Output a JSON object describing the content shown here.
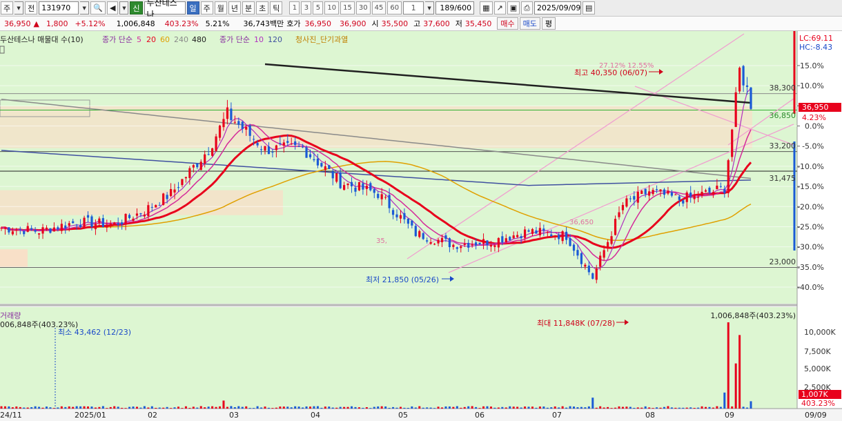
{
  "toolbar": {
    "market_select": "주",
    "prev_button": "전",
    "code": "131970",
    "stock_name": "두산테스나",
    "credit_badge": "신",
    "periods": [
      "일",
      "주",
      "월",
      "년",
      "분",
      "초",
      "틱"
    ],
    "active_period": "일",
    "interval_buttons": [
      "1",
      "3",
      "5",
      "10",
      "15",
      "30",
      "45",
      "60"
    ],
    "interval_value": "1",
    "page_counter": "189/600",
    "date": "2025/09/09"
  },
  "quote": {
    "price": "36,950",
    "change_arrow": "▲",
    "change": "1,800",
    "change_pct": "+5.12%",
    "volume": "1,006,848",
    "volume_ratio": "403.23%",
    "turnover_pct": "5.21%",
    "amount": "36,743백만",
    "hoga_label": "호가",
    "ask": "36,950",
    "bid": "36,900",
    "open_label": "시",
    "open": "35,500",
    "high_label": "고",
    "high": "37,600",
    "low_label": "저",
    "low": "35,450",
    "buy_button": "매수",
    "sell_button": "매도",
    "eval_button": "평"
  },
  "legend": {
    "title": "두산테스나 매물대 수(10)",
    "ma_price_label": "종가 단순",
    "ma_price_periods": [
      {
        "label": "5",
        "color": "#d42a9a"
      },
      {
        "label": "20",
        "color": "#e8001c"
      },
      {
        "label": "60",
        "color": "#e0a000"
      },
      {
        "label": "240",
        "color": "#8a8a8a"
      },
      {
        "label": "480",
        "color": "#202020"
      }
    ],
    "ma_price2_label": "종가 단순",
    "ma_price2_periods": [
      {
        "label": "10",
        "color": "#b030c0"
      },
      {
        "label": "120",
        "color": "#4050a0"
      }
    ],
    "signal_label": "청사진_단기과열"
  },
  "right_axis": {
    "lc": "LC:69.11",
    "hc": "HC:-8.43",
    "pct_ticks": [
      "15.0%",
      "10.0%",
      "5.0%",
      "0.0%",
      "-5.0%",
      "-10.0%",
      "-15.0%",
      "-20.0%",
      "-25.0%",
      "-30.0%",
      "-35.0%",
      "-40.0%"
    ],
    "current_price_tag": "36,950",
    "current_pct_tag": "4.23%"
  },
  "levels": [
    "38,300",
    "36,850",
    "33,200",
    "31,475",
    "23,000"
  ],
  "annotations": {
    "max_label": "최고 40,350 (06/07)",
    "min_label": "최저 21,850 (05/26)",
    "pct_near_max": "27.12% 12.55%",
    "price_label_mid": "36,650",
    "price_label_35": "35,"
  },
  "volume": {
    "title": "거래량",
    "current": "006,848주(403.23%)",
    "right_current": "1,006,848주(403.23%)",
    "min_label": "최소 43,462 (12/23)",
    "max_label": "최대 11,848K (07/28)",
    "ticks": [
      "10,000K",
      "7,500K",
      "5,000K",
      "2,500K"
    ],
    "tag_value": "1,007K",
    "tag_pct": "403.23%"
  },
  "x_axis": [
    "24/11",
    "2025/01",
    "02",
    "03",
    "04",
    "05",
    "06",
    "07",
    "08",
    "09",
    "09/09"
  ],
  "chart_data": {
    "type": "candlestick",
    "price_axis_range": [
      21850,
      40350
    ],
    "pct_range": [
      -40,
      15
    ],
    "reference_price": 35450,
    "max": {
      "price": 40350,
      "date": "06/07"
    },
    "min": {
      "price": 21850,
      "date": "05/26"
    },
    "volume_max": {
      "value_k": 11848,
      "date": "07/28"
    },
    "volume_min": {
      "value": 43462,
      "date": "12/23"
    }
  },
  "colors": {
    "chart_bg": "#ddf6d2",
    "panel_bg": "#f0f8e8",
    "up": "#e8001c",
    "down": "#1a5ad6",
    "ma5": "#d42a9a",
    "ma20": "#e8001c",
    "ma60": "#e0a000",
    "ma240": "#8a8a8a",
    "ma480": "#202020",
    "ma120": "#4050a0",
    "channel": "#f0a0d0",
    "volume_profile": "#f8e0c8"
  }
}
